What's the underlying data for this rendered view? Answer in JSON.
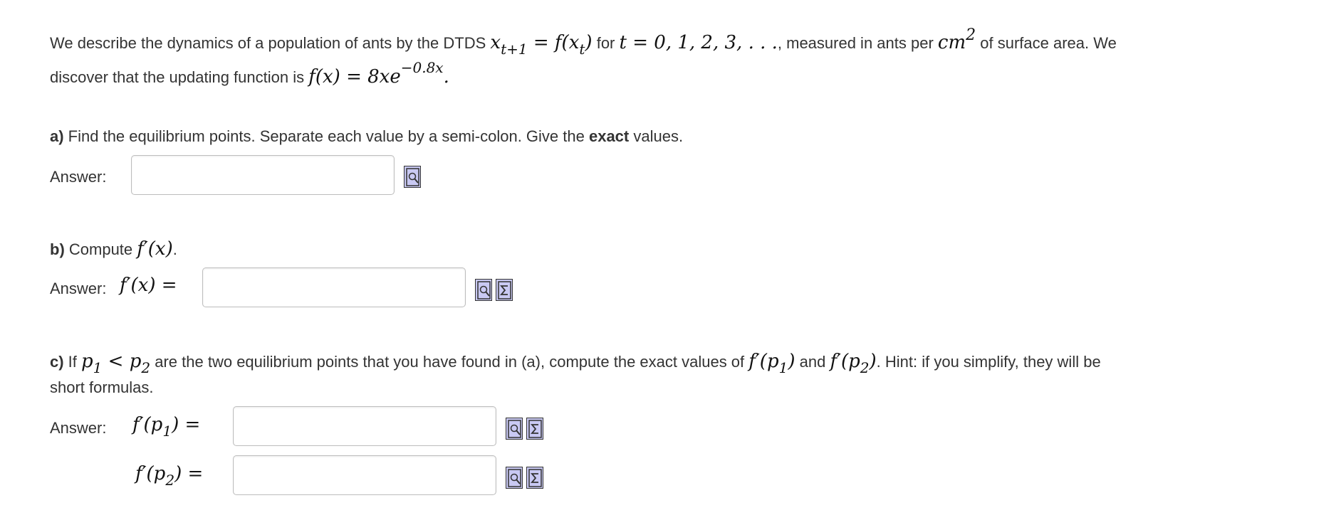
{
  "intro": {
    "p1": "We describe the dynamics of a population of ants by the DTDS",
    "p2": "for",
    "p3": ", measured in ants per",
    "p4": "of surface area.  We",
    "p5": "discover that the updating function is",
    "math": {
      "x": "x",
      "t1": "t+1",
      "eq": " = ",
      "f": "f",
      "lp": "(",
      "rp": ")",
      "t": "t",
      "tvals": "t = 0, 1, 2, 3, . . .",
      "cm": "cm",
      "two": "2",
      "fx": "f(x) = 8xe",
      "exp": "−0.8x",
      "period": "."
    }
  },
  "part_a": {
    "letter": "a)",
    "text1": " Find the equilibrium points.  Separate each value by a semi-colon.  Give the ",
    "bold": "exact",
    "text2": " values.",
    "answer_label": "Answer:",
    "input_value": "",
    "icon": "preview-icon"
  },
  "part_b": {
    "letter": "b)",
    "text": " Compute ",
    "math": "f′(x)",
    "period": ".",
    "answer_label": "Answer:",
    "answer_math": "f′(x) =",
    "input_value": "",
    "icons": [
      "preview-icon",
      "equation-editor-icon"
    ]
  },
  "part_c": {
    "letter": "c)",
    "t1": " If ",
    "p1": "p",
    "one": "1",
    "lt": " < ",
    "p2": "p",
    "two": "2",
    "t2": " are the two equilibrium points that you have found in (a), compute the exact values of ",
    "fp": "f′(",
    "rp": ")",
    "and": " and ",
    "t3": ".  Hint: if you simplify, they will be",
    "line2": "short formulas.",
    "answer_label": "Answer:",
    "eq1": "f′(p",
    "eq1b": "1",
    "eq1c": ") =",
    "eq2": "f′(p",
    "eq2b": "2",
    "eq2c": ") =",
    "input1_value": "",
    "input2_value": ""
  }
}
